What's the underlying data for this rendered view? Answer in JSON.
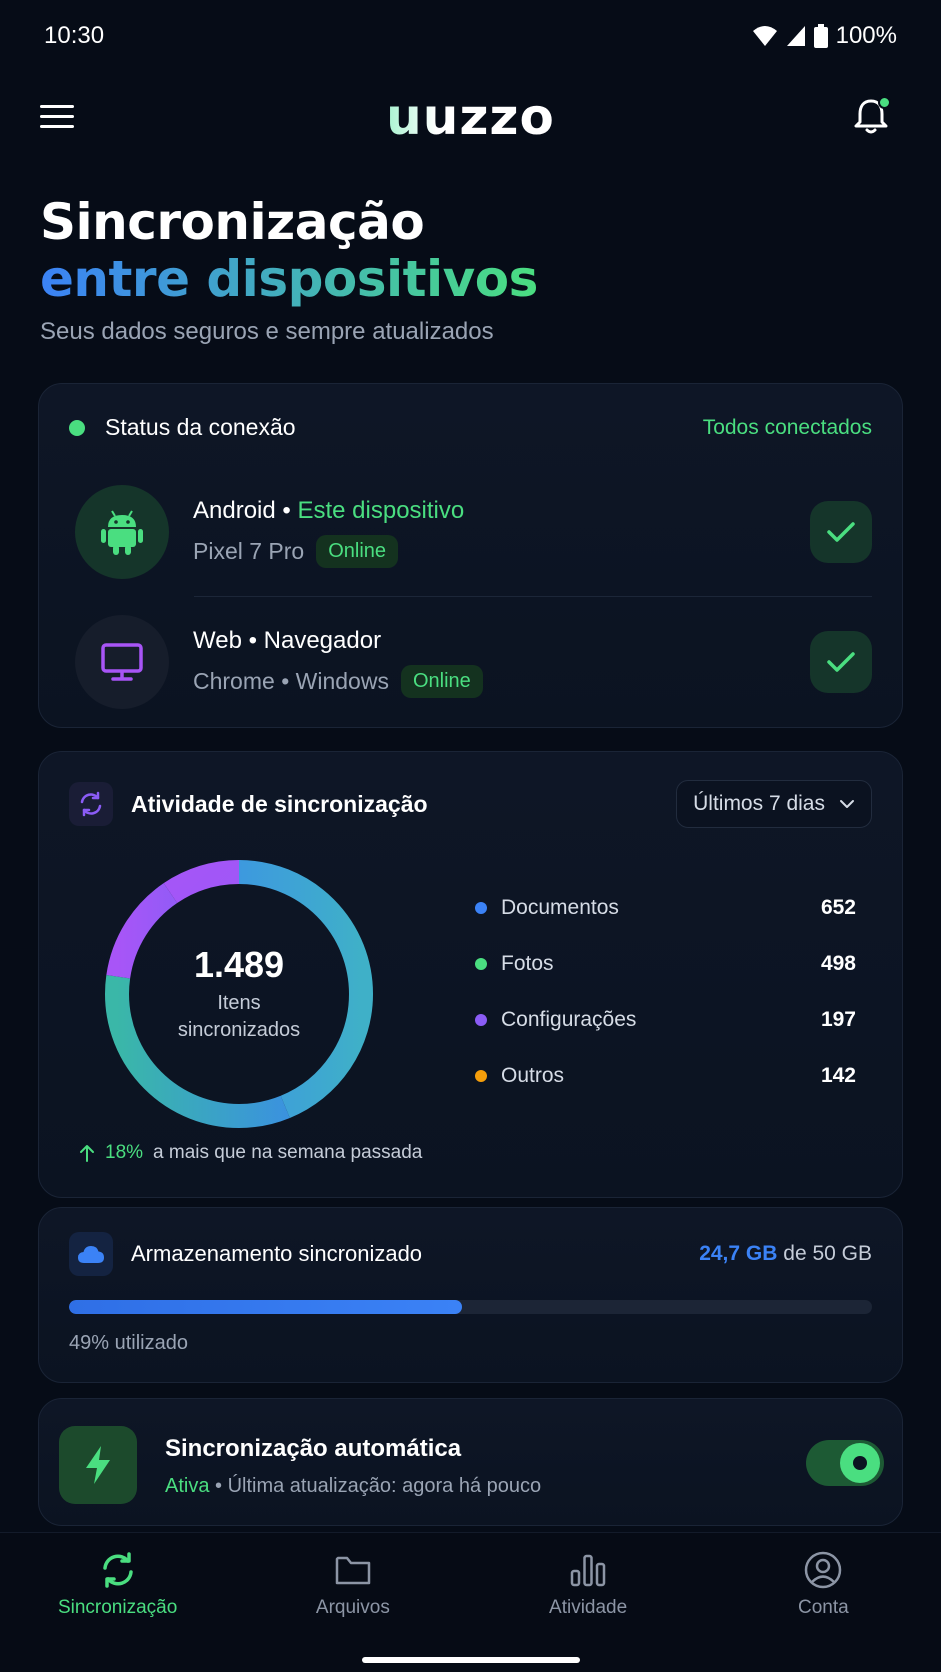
{
  "status_bar": {
    "time": "10:30",
    "battery": "100%"
  },
  "app_bar": {
    "logo": "uuzzo"
  },
  "hero": {
    "title_line1": "Sincronização",
    "title_line2": "entre dispositivos",
    "subtitle": "Seus dados seguros e sempre atualizados"
  },
  "connection": {
    "title": "Status da conexão",
    "status": "Todos conectados",
    "devices": [
      {
        "name": "Android",
        "separator": " • ",
        "tag": "Este dispositivo",
        "model": "Pixel 7 Pro",
        "badge": "Online",
        "icon": "android-icon"
      },
      {
        "name": "Web • Navegador",
        "model": "Chrome • Windows",
        "badge": "Online",
        "icon": "monitor-icon"
      }
    ]
  },
  "activity": {
    "title": "Atividade de sincronização",
    "period": "Últimos 7 dias",
    "total": "1.489",
    "total_label_1": "Itens",
    "total_label_2": "sincronizados",
    "growth_pct": "18%",
    "growth_text": "a mais que na semana passada",
    "legend": [
      {
        "name": "Documentos",
        "value": "652",
        "color": "#3b82f6"
      },
      {
        "name": "Fotos",
        "value": "498",
        "color": "#4ade80"
      },
      {
        "name": "Configurações",
        "value": "197",
        "color": "#8b5cf6"
      },
      {
        "name": "Outros",
        "value": "142",
        "color": "#f59e0b"
      }
    ]
  },
  "chart_data": {
    "type": "pie",
    "categories": [
      "Documentos",
      "Fotos",
      "Configurações",
      "Outros"
    ],
    "values": [
      652,
      498,
      197,
      142
    ],
    "title": "Atividade de sincronização"
  },
  "storage": {
    "title": "Armazenamento sincronizado",
    "used": "24,7 GB",
    "of_text": "de 50 GB",
    "used_fraction": 0.49,
    "usage_text": "49% utilizado"
  },
  "auto_sync": {
    "title": "Sincronização automática",
    "state": "Ativa",
    "detail": " • Última atualização: agora há pouco",
    "enabled": true
  },
  "nav": [
    {
      "label": "Sincronização",
      "icon": "sync-icon",
      "active": true
    },
    {
      "label": "Arquivos",
      "icon": "folder-icon",
      "active": false
    },
    {
      "label": "Atividade",
      "icon": "bar-chart-icon",
      "active": false
    },
    {
      "label": "Conta",
      "icon": "user-icon",
      "active": false
    }
  ],
  "colors": {
    "accent_green": "#4ade80",
    "accent_blue": "#3b82f6",
    "background": "#060c17"
  }
}
